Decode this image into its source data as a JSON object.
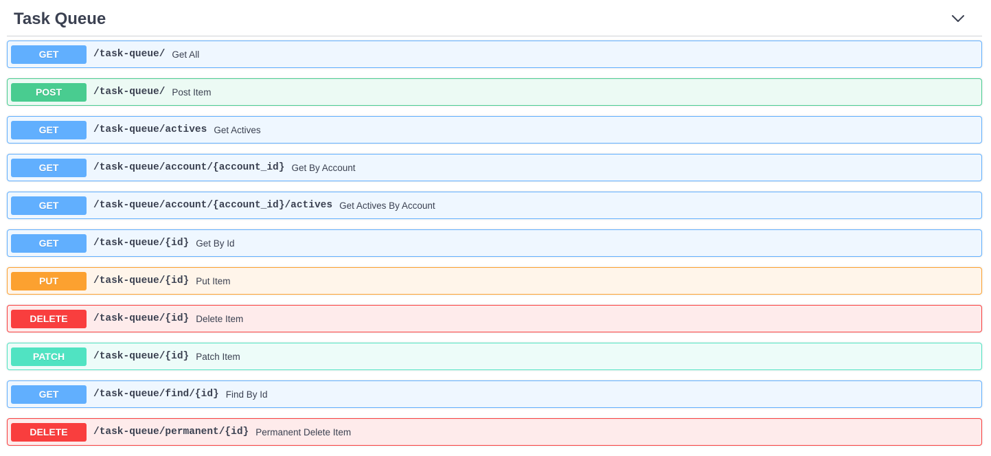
{
  "tag": {
    "title": "Task Queue",
    "toggle_icon": "chevron-down-icon"
  },
  "method_colors": {
    "GET": "#61affe",
    "POST": "#49cc90",
    "PUT": "#fca130",
    "DELETE": "#f93e3e",
    "PATCH": "#50e3c2"
  },
  "operations": [
    {
      "method": "GET",
      "path": "/task-queue/",
      "summary": "Get All"
    },
    {
      "method": "POST",
      "path": "/task-queue/",
      "summary": "Post Item"
    },
    {
      "method": "GET",
      "path": "/task-queue/actives",
      "summary": "Get Actives"
    },
    {
      "method": "GET",
      "path": "/task-queue/account/{account_id}",
      "summary": "Get By Account"
    },
    {
      "method": "GET",
      "path": "/task-queue/account/{account_id}/actives",
      "summary": "Get Actives By Account"
    },
    {
      "method": "GET",
      "path": "/task-queue/{id}",
      "summary": "Get By Id"
    },
    {
      "method": "PUT",
      "path": "/task-queue/{id}",
      "summary": "Put Item"
    },
    {
      "method": "DELETE",
      "path": "/task-queue/{id}",
      "summary": "Delete Item"
    },
    {
      "method": "PATCH",
      "path": "/task-queue/{id}",
      "summary": "Patch Item"
    },
    {
      "method": "GET",
      "path": "/task-queue/find/{id}",
      "summary": "Find By Id"
    },
    {
      "method": "DELETE",
      "path": "/task-queue/permanent/{id}",
      "summary": "Permanent Delete Item"
    }
  ]
}
